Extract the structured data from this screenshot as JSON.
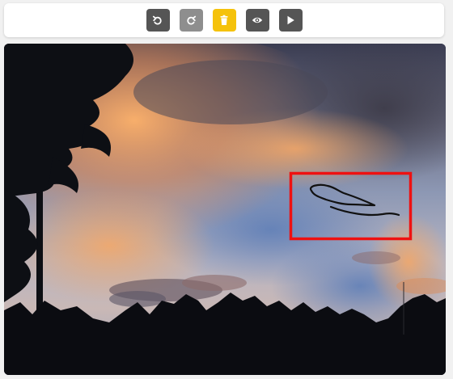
{
  "toolbar": {
    "buttons": [
      {
        "name": "undo-button",
        "icon": "undo-icon",
        "color": "#555555"
      },
      {
        "name": "redo-button",
        "icon": "redo-icon",
        "color": "#8e8e8e"
      },
      {
        "name": "delete-button",
        "icon": "trash-icon",
        "color": "#f5c20b"
      },
      {
        "name": "preview-button",
        "icon": "eye-icon",
        "color": "#555555"
      },
      {
        "name": "play-button",
        "icon": "play-icon",
        "color": "#555555"
      }
    ]
  },
  "canvas": {
    "photo": "sunset-sky-with-tree-silhouettes",
    "annotation": {
      "shape": "rectangle",
      "stroke_color": "#ee1111",
      "drawing": "freehand-squiggle",
      "drawing_color": "#111111"
    }
  }
}
